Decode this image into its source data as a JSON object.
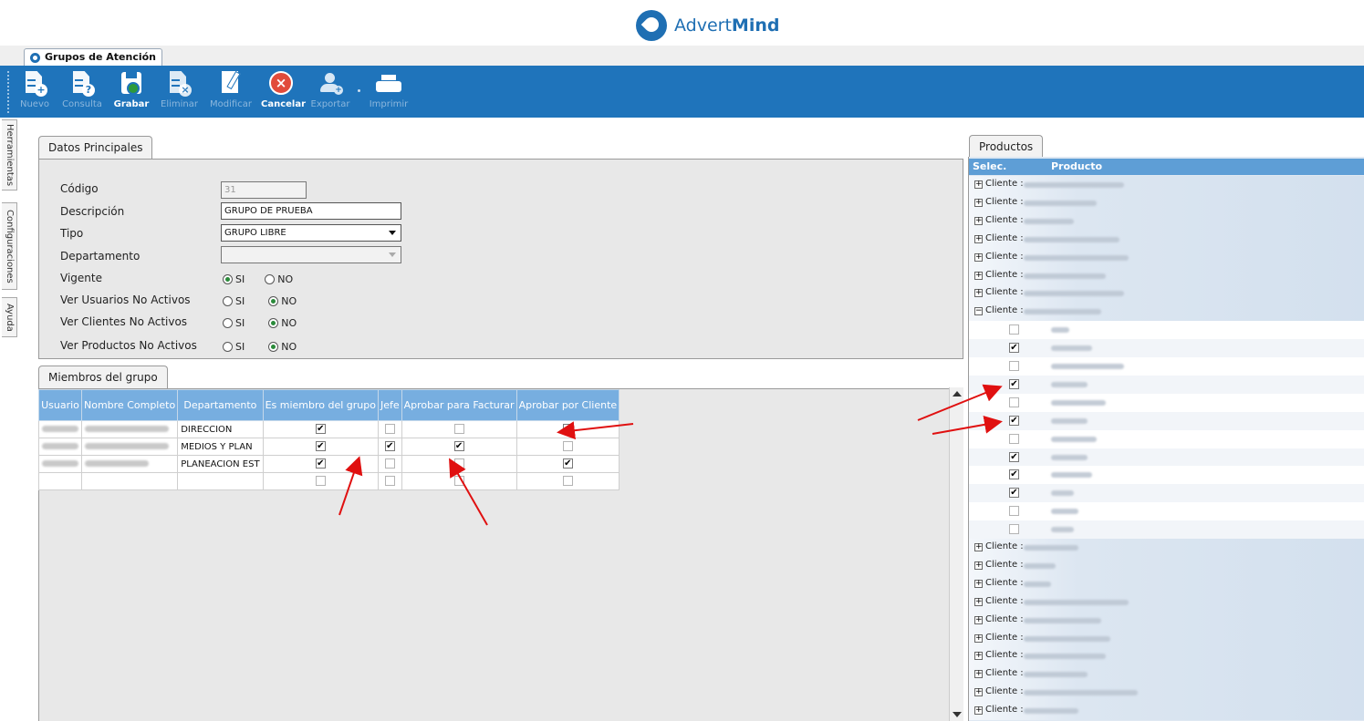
{
  "logo": {
    "text_light": "Advert",
    "text_bold": "Mind"
  },
  "main_tab": {
    "label": "Grupos de Atención"
  },
  "toolbar": {
    "nuevo": "Nuevo",
    "consulta": "Consulta",
    "grabar": "Grabar",
    "eliminar": "Eliminar",
    "modificar": "Modificar",
    "cancelar": "Cancelar",
    "exportar": "Exportar",
    "imprimir": "Imprimir"
  },
  "side_tabs": {
    "herramientas": "Herramientas",
    "configuraciones": "Configuraciones",
    "ayuda": "Ayuda"
  },
  "datos": {
    "tab": "Datos Principales",
    "codigo_label": "Código",
    "codigo_value": "31",
    "descripcion_label": "Descripción",
    "descripcion_value": "GRUPO DE PRUEBA",
    "tipo_label": "Tipo",
    "tipo_value": "GRUPO LIBRE",
    "departamento_label": "Departamento",
    "departamento_value": "",
    "vigente_label": "Vigente",
    "ver_usuarios_label": "Ver Usuarios No Activos",
    "ver_clientes_label": "Ver Clientes No Activos",
    "ver_productos_label": "Ver Productos No Activos",
    "si": "SI",
    "no": "NO"
  },
  "miembros": {
    "tab": "Miembros del grupo",
    "columns": [
      "Usuario",
      "Nombre Completo",
      "Departamento",
      "Es miembro del grupo",
      "Jefe",
      "Aprobar para Facturar",
      "Aprobar por Cliente"
    ],
    "rows": [
      {
        "departamento": "DIRECCION",
        "miembro": "✔",
        "jefe": "",
        "facturar": "",
        "cliente": "✔"
      },
      {
        "departamento": "MEDIOS Y PLAN",
        "miembro": "✔",
        "jefe": "✔",
        "facturar": "✔",
        "cliente": ""
      },
      {
        "departamento": "PLANEACION EST",
        "miembro": "✔",
        "jefe": "",
        "facturar": "",
        "cliente": "✔"
      }
    ]
  },
  "productos": {
    "tab": "Productos",
    "col_selec": "Selec.",
    "col_producto": "Producto",
    "client_label": "Cliente :",
    "expand": "+",
    "collapse": "−",
    "items_checked": [
      "",
      "✔",
      "",
      "✔",
      "",
      "✔",
      "",
      "✔",
      "✔",
      "✔",
      "",
      ""
    ]
  },
  "colors": {
    "toolbar": "#1f74bb",
    "grid_header": "#77aee0",
    "annotation_arrow": "#e01010"
  }
}
